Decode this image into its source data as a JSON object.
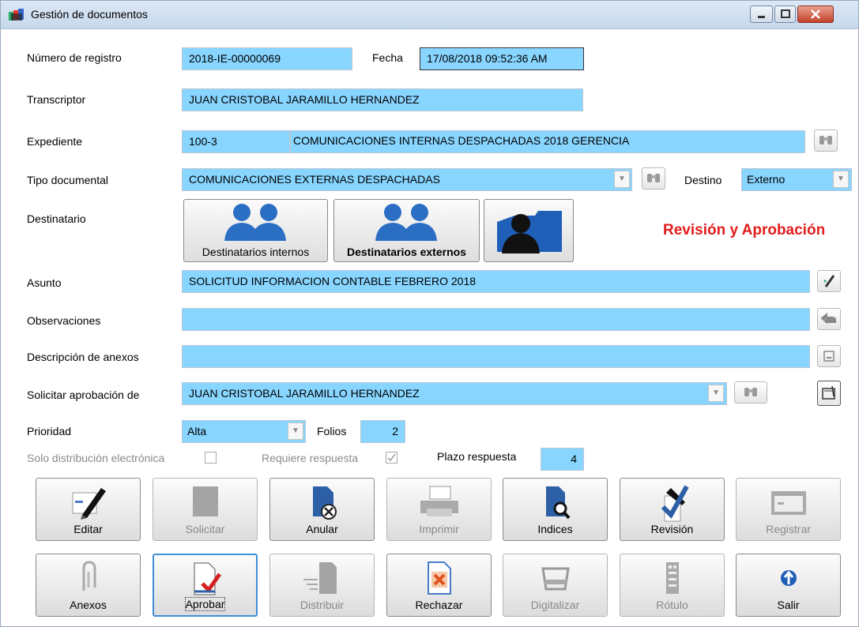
{
  "window": {
    "title": "Gestión de documentos"
  },
  "form": {
    "registro": {
      "label": "Número de registro",
      "value": "2018-IE-00000069"
    },
    "fecha": {
      "label": "Fecha",
      "value": "17/08/2018 09:52:36 AM"
    },
    "transcriptor": {
      "label": "Transcriptor",
      "value": "JUAN CRISTOBAL JARAMILLO HERNANDEZ"
    },
    "expediente": {
      "label": "Expediente",
      "code": "100-3",
      "name": "COMUNICACIONES INTERNAS DESPACHADAS 2018 GERENCIA"
    },
    "tipo": {
      "label": "Tipo documental",
      "value": "COMUNICACIONES EXTERNAS DESPACHADAS"
    },
    "destino": {
      "label": "Destino",
      "value": "Externo"
    },
    "destinatario": {
      "label": "Destinatario",
      "internos": "Destinatarios internos",
      "externos": "Destinatarios externos"
    },
    "status": "Revisión y Aprobación",
    "asunto": {
      "label": "Asunto",
      "value": "SOLICITUD INFORMACION CONTABLE FEBRERO 2018"
    },
    "observaciones": {
      "label": "Observaciones",
      "value": ""
    },
    "anexos_desc": {
      "label": "Descripción de anexos",
      "value": ""
    },
    "aprobacion": {
      "label": "Solicitar aprobación de",
      "value": "JUAN CRISTOBAL JARAMILLO HERNANDEZ"
    },
    "prioridad": {
      "label": "Prioridad",
      "value": "Alta"
    },
    "folios": {
      "label": "Folios",
      "value": "2"
    },
    "solo_dist": {
      "label": "Solo distribución electrónica",
      "checked": false
    },
    "requiere": {
      "label": "Requiere respuesta",
      "checked": true
    },
    "plazo": {
      "label": "Plazo respuesta",
      "value": "4"
    }
  },
  "actions": {
    "row1": [
      "Editar",
      "Solicitar",
      "Anular",
      "Imprimir",
      "Indices",
      "Revisión",
      "Registrar"
    ],
    "row2": [
      "Anexos",
      "Aprobar",
      "Distribuir",
      "Rechazar",
      "Digitalizar",
      "Rótulo",
      "Salir"
    ]
  },
  "colors": {
    "field": "#88d5ff",
    "status": "#e31c1c",
    "focus": "#3d8fd8"
  }
}
